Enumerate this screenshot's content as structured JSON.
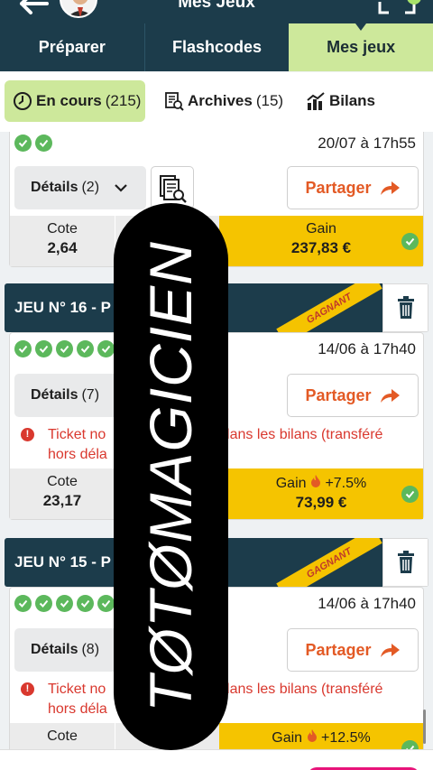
{
  "header": {
    "title": "Mes Jeux"
  },
  "tabs": [
    {
      "label": "Préparer"
    },
    {
      "label": "Flashcodes"
    },
    {
      "label": "Mes jeux"
    }
  ],
  "subtabs": {
    "en_cours": {
      "label": "En cours",
      "count": "(215)"
    },
    "archives": {
      "label": "Archives",
      "count": "(15)"
    },
    "bilans": {
      "label": "Bilans"
    }
  },
  "cards": [
    {
      "date": "20/07 à 17h55",
      "details_label": "Détails",
      "details_count": "(2)",
      "share_label": "Partager",
      "cote_label": "Cote",
      "cote_value": "2,64",
      "gain_label": "Gain",
      "gain_value": "237,83 €"
    },
    {
      "title": "JEU N° 16 - P",
      "ribbon": "GAGNANT",
      "date": "14/06 à 17h40",
      "details_label": "Détails",
      "details_count": "(7)",
      "share_label": "Partager",
      "warning_line1_a": "Ticket no",
      "warning_line1_b": "e dans les bilans (transféré",
      "warning_line2": "hors déla",
      "cote_label": "Cote",
      "cote_value": "23,17",
      "gain_label": "Gain",
      "gain_bonus": "+7.5%",
      "gain_value": "73,99 €"
    },
    {
      "title": "JEU N° 15 - P",
      "ribbon": "GAGNANT",
      "date": "14/06 à 17h40",
      "details_label": "Détails",
      "details_count": "(8)",
      "share_label": "Partager",
      "warning_line1_a": "Ticket no",
      "warning_line1_b": "e dans les bilans (transféré",
      "warning_line2": "hors déla",
      "cote_label": "Cote",
      "gain_label": "Gain",
      "gain_bonus": "+12.5%"
    }
  ],
  "watermark": {
    "text": "TØTØMAGICIEN"
  },
  "colors": {
    "navy": "#1c3c4b",
    "lime": "#cde89b",
    "yellow": "#f5c400",
    "orange": "#e35a25",
    "green": "#5cb85c",
    "red": "#d9382e"
  }
}
